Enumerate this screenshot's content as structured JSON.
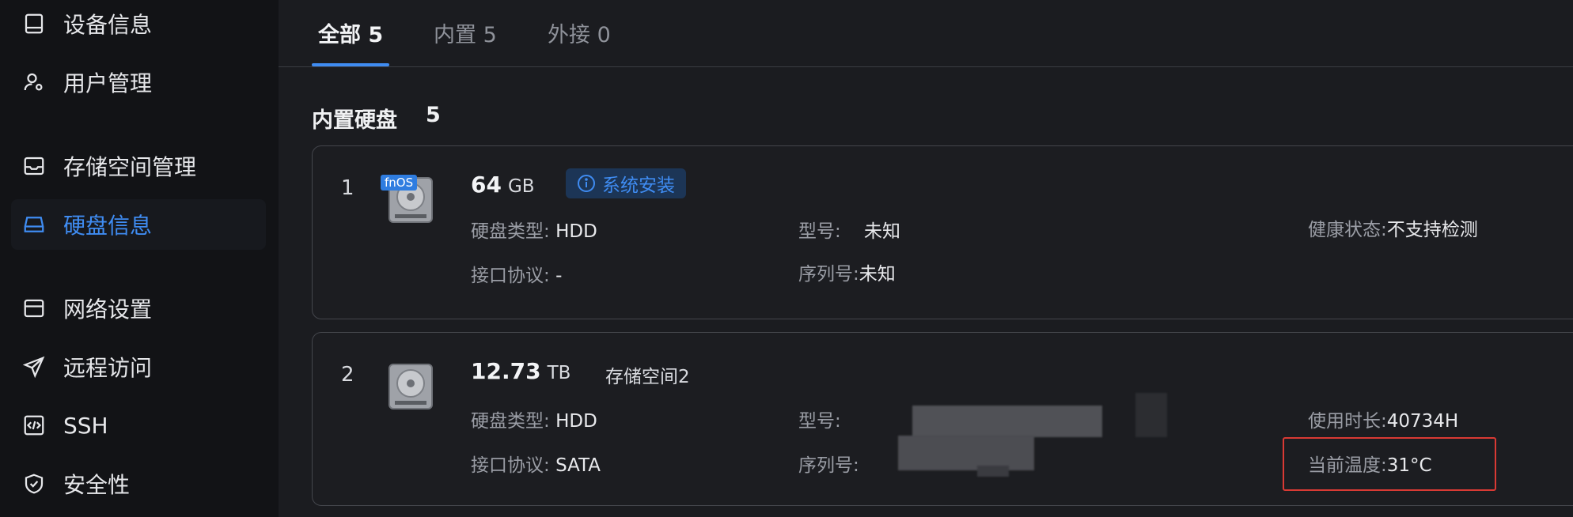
{
  "sidebar": {
    "items": [
      {
        "label": "设备信息",
        "icon": "device-icon"
      },
      {
        "label": "用户管理",
        "icon": "user-settings-icon"
      },
      {
        "label": "存储空间管理",
        "icon": "storage-icon"
      },
      {
        "label": "硬盘信息",
        "icon": "hard-disk-icon",
        "active": true
      },
      {
        "label": "网络设置",
        "icon": "network-icon"
      },
      {
        "label": "远程访问",
        "icon": "send-icon"
      },
      {
        "label": "SSH",
        "icon": "code-icon"
      },
      {
        "label": "安全性",
        "icon": "shield-icon"
      }
    ]
  },
  "tabs": [
    {
      "label": "全部 5",
      "active": true
    },
    {
      "label": "内置 5"
    },
    {
      "label": "外接 0"
    }
  ],
  "section": {
    "title": "内置硬盘",
    "count": "5"
  },
  "disks": [
    {
      "index": "1",
      "badge_icon_text": "fnOS",
      "size": "64",
      "unit": "GB",
      "badge": "系统安装",
      "fields": {
        "type_label": "硬盘类型:",
        "type_value": "HDD",
        "interface_label": "接口协议:",
        "interface_value": "-",
        "model_label": "型号:",
        "model_value": "未知",
        "serial_label": "序列号:",
        "serial_value": "未知",
        "health_label": "健康状态:",
        "health_value": "不支持检测"
      }
    },
    {
      "index": "2",
      "size": "12.73",
      "unit": "TB",
      "pool": "存储空间2",
      "fields": {
        "type_label": "硬盘类型:",
        "type_value": "HDD",
        "interface_label": "接口协议:",
        "interface_value": "SATA",
        "model_label": "型号:",
        "serial_label": "序列号:",
        "uptime_label": "使用时长:",
        "uptime_value": "40734H",
        "temp_label": "当前温度:",
        "temp_value": "31°C"
      }
    }
  ],
  "colors": {
    "accent": "#3f8cf2",
    "highlight": "#d93a34",
    "background": "#1b1c20"
  }
}
